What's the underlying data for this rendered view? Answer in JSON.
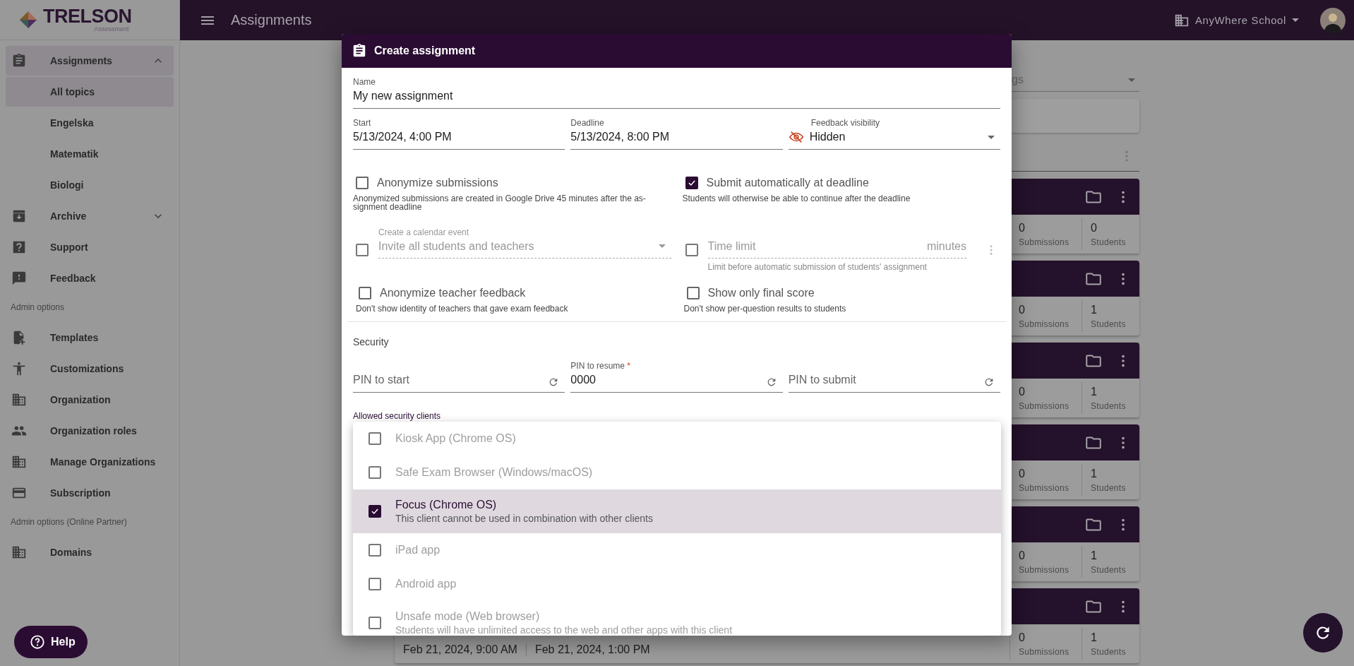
{
  "app": {
    "logo": "TRELSON",
    "logo_sub": "Assessment"
  },
  "top_bar": {
    "title": "Assignments",
    "organization": "AnyWhere School"
  },
  "sidebar": {
    "entries": [
      {
        "kind": "item",
        "label": "Assignments",
        "selected": true,
        "expanded": true,
        "children": [
          {
            "label": "All topics",
            "selected": true
          },
          {
            "label": "Engelska",
            "selected": false
          },
          {
            "label": "Matematik",
            "selected": false
          },
          {
            "label": "Biologi",
            "selected": false
          }
        ]
      },
      {
        "kind": "item",
        "label": "Archive",
        "selected": false,
        "expanded": false
      },
      {
        "kind": "item",
        "label": "Support",
        "selected": false
      },
      {
        "kind": "item",
        "label": "Feedback",
        "selected": false
      },
      {
        "kind": "header",
        "label": "Admin options"
      },
      {
        "kind": "item",
        "label": "Templates",
        "selected": false
      },
      {
        "kind": "item",
        "label": "Customizations",
        "selected": false
      },
      {
        "kind": "item",
        "label": "Organization",
        "selected": false
      },
      {
        "kind": "item",
        "label": "Organization roles",
        "selected": false
      },
      {
        "kind": "item",
        "label": "Manage Organizations",
        "selected": false
      },
      {
        "kind": "item",
        "label": "Subscription",
        "selected": false
      },
      {
        "kind": "header",
        "label": "Admin options (Online Partner)"
      },
      {
        "kind": "item",
        "label": "Domains",
        "selected": false
      }
    ],
    "help": "Help"
  },
  "list": {
    "filter": {
      "value": "gs"
    },
    "cards": [
      {
        "submissions": "0",
        "submissions_label": "Submissions",
        "students": "0",
        "students_label": "Students"
      },
      {
        "submissions": "0",
        "submissions_label": "Submissions",
        "students": "1",
        "students_label": "Students"
      },
      {
        "submissions": "0",
        "submissions_label": "Submissions",
        "students": "1",
        "students_label": "Students"
      },
      {
        "submissions": "0",
        "submissions_label": "Submissions",
        "students": "1",
        "students_label": "Students"
      },
      {
        "submissions": "0",
        "submissions_label": "Submissions",
        "students": "1",
        "students_label": "Students"
      },
      {
        "submissions": "0",
        "submissions_label": "Submissions",
        "students": "1",
        "students_label": "Students",
        "start": "Feb 21, 2024, 9:00 AM",
        "deadline": "Feb 21, 2024, 1:00 PM"
      }
    ]
  },
  "dialog": {
    "title": "Create assignment",
    "name": {
      "label": "Name",
      "value": "My new assignment"
    },
    "start": {
      "label": "Start",
      "value": "5/13/2024, 4:00 PM"
    },
    "deadline": {
      "label": "Deadline",
      "value": "5/13/2024, 8:00 PM"
    },
    "feedback_visibility": {
      "label": "Feedback visibility",
      "value": "Hidden"
    },
    "options": [
      {
        "label": "Anonymize submissions",
        "checked": false,
        "hint": "Anonymized submissions are created in Google Drive 45 minutes after the as-signment deadline"
      },
      {
        "label": "Submit automatically at deadline",
        "checked": true,
        "hint": "Students will otherwise be able to continue after the deadline"
      }
    ],
    "calendar": {
      "checked": false,
      "disabled": true,
      "label": "Create a calendar event",
      "value": "Invite all students and teachers"
    },
    "time_limit": {
      "checked": false,
      "disabled": true,
      "placeholder": "Time limit",
      "suffix": "minutes",
      "hint": "Limit before automatic submission of students' assignment"
    },
    "options_2": [
      {
        "label": "Anonymize teacher feedback",
        "checked": false,
        "hint": "Don't show identity of teachers that gave exam feedback"
      },
      {
        "label": "Show only final score",
        "checked": false,
        "hint": "Don't show per-question results to students"
      }
    ],
    "security": {
      "title": "Security",
      "pins": [
        {
          "placeholder": "PIN to start"
        },
        {
          "label": "PIN to resume",
          "required_mark": "*",
          "value": "0000"
        },
        {
          "placeholder": "PIN to submit"
        }
      ],
      "clients_label": "Allowed security clients",
      "clients": [
        {
          "label": "Kiosk App (Chrome OS)",
          "checked": false,
          "selected": false,
          "disabled": true
        },
        {
          "label": "Safe Exam Browser (Windows/macOS)",
          "checked": false,
          "selected": false,
          "disabled": true
        },
        {
          "label": "Focus (Chrome OS)",
          "checked": true,
          "selected": true,
          "disabled": false,
          "hint": "This client cannot be used in combination with other clients"
        },
        {
          "label": "iPad app",
          "checked": false,
          "selected": false,
          "disabled": true
        },
        {
          "label": "Android app",
          "checked": false,
          "selected": false,
          "disabled": true
        },
        {
          "label": "Unsafe mode (Web browser)",
          "checked": false,
          "selected": false,
          "disabled": true,
          "hint": "Students will have unlimited access to the web and other apps with this client"
        }
      ]
    }
  }
}
